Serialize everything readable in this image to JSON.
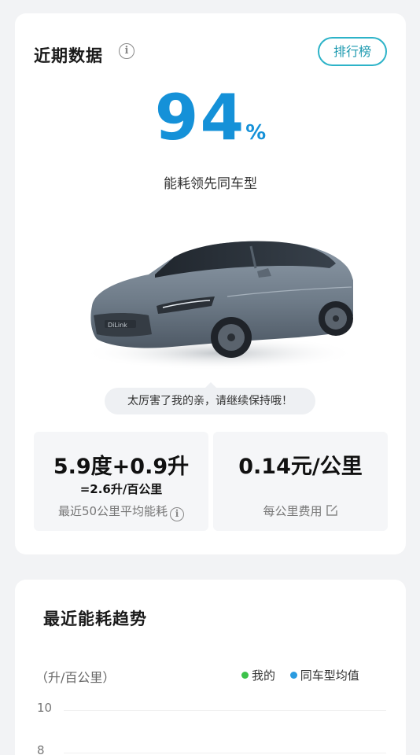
{
  "recent": {
    "title": "近期数据",
    "rank_label": "排行榜",
    "percent_value": "94",
    "percent_unit": "%",
    "lead_text": "能耗领先同车型",
    "car_badge": "DiLink",
    "bubble_text": "太厉害了我的亲，请继续保持哦！",
    "stats": {
      "consumption_main": "5.9度+0.9升",
      "consumption_equiv": "=2.6升/百公里",
      "consumption_caption": "最近50公里平均能耗",
      "cost_main": "0.14元/公里",
      "cost_caption": "每公里费用"
    }
  },
  "trend": {
    "title": "最近能耗趋势",
    "unit": "（升/百公里）",
    "legend": [
      {
        "label": "我的",
        "color": "#3cc24a"
      },
      {
        "label": "同车型均值",
        "color": "#2a9be0"
      }
    ],
    "y_ticks": [
      "10",
      "8"
    ]
  },
  "colors": {
    "accent_blue": "#1591d8",
    "button_teal": "#2db3c8"
  }
}
